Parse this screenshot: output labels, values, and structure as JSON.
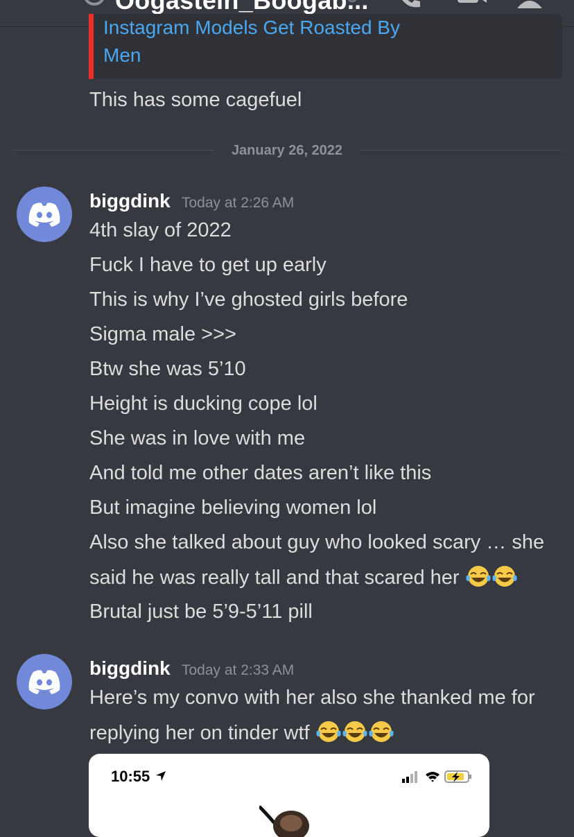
{
  "topbar": {
    "title": "Oogastein_Boogab...",
    "icons": [
      "hamburger-menu-icon",
      "at-sign-icon",
      "chevron-down-icon",
      "phone-call-icon",
      "video-call-icon",
      "members-icon"
    ]
  },
  "embed": {
    "line1": "Instagram Models Get Roasted By",
    "line2": "Men",
    "accent_color": "#ed2d28"
  },
  "prev_message": {
    "text": "This has some cagefuel"
  },
  "divider": {
    "date": "January 26, 2022"
  },
  "messages": [
    {
      "username": "biggdink",
      "timestamp": "Today at 2:26 AM",
      "lines": [
        "4th slay of 2022",
        "Fuck I have to get up early",
        "This is why I’ve ghosted girls before",
        "Sigma male >>>",
        "Btw she was 5’10",
        "Height is ducking cope lol",
        "She was in love with me",
        "And told me other dates aren’t like this",
        "But imagine believing women lol",
        "Also she talked about guy who looked scary … she",
        "said he was really tall and that scared her",
        "Brutal just be 5’9-5’11 pill"
      ]
    },
    {
      "username": "biggdink",
      "timestamp": "Today at 2:33 AM",
      "lines": [
        "Here’s my convo with her also she thanked me for",
        "replying her on tinder wtf"
      ]
    }
  ],
  "attachment": {
    "time": "10:55"
  },
  "colors": {
    "background": "#36393f",
    "avatar": "#7289da",
    "link": "#4aa8f2"
  }
}
